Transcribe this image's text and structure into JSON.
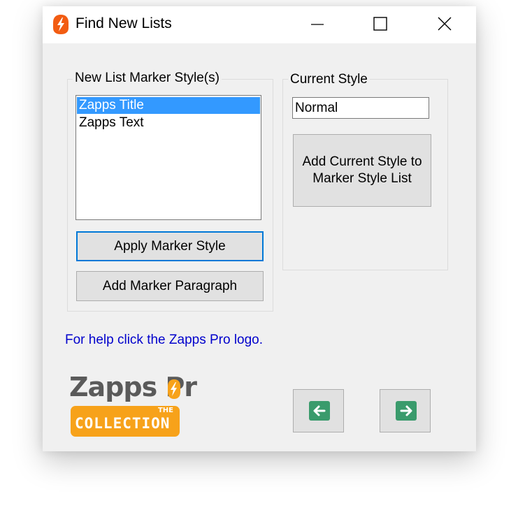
{
  "window": {
    "title": "Find New Lists",
    "icon": "zapps-bolt-icon",
    "controls": [
      "minimize-icon",
      "maximize-icon",
      "close-icon"
    ]
  },
  "marker_group": {
    "label": "New List Marker Style(s)",
    "items": [
      {
        "label": "Zapps Title",
        "selected": true
      },
      {
        "label": "Zapps Text",
        "selected": false
      }
    ],
    "apply_button": "Apply Marker Style",
    "add_paragraph_button": "Add Marker Paragraph"
  },
  "current_style_group": {
    "label": "Current Style",
    "value": "Normal",
    "add_button": "Add Current Style to Marker Style List"
  },
  "help_text": "For help click the Zapps Pro logo.",
  "logo": {
    "name": "Zapps Pr",
    "the": "THE",
    "collection": "COLLECTION"
  },
  "navigation": {
    "prev_icon": "arrow-left-icon",
    "next_icon": "arrow-right-icon"
  },
  "colors": {
    "selection": "#3399ff",
    "focus_border": "#0078d7",
    "help_link": "#0000cc",
    "logo_orange": "#f7a21a",
    "nav_arrow": "#3a9b6c"
  }
}
